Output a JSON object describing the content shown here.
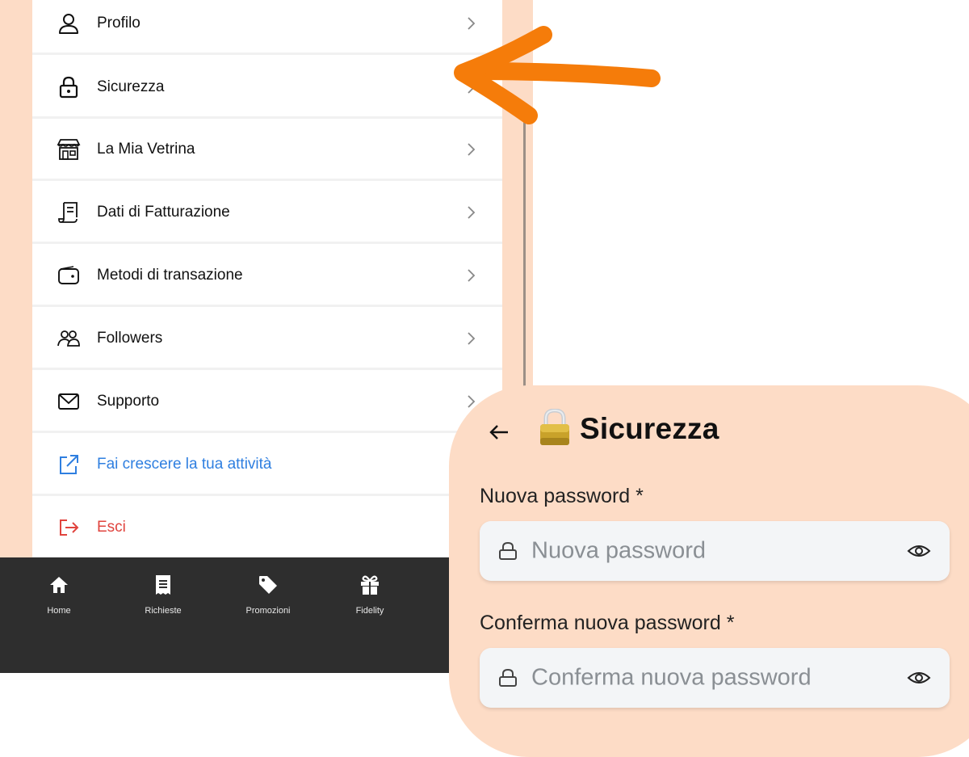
{
  "menu": {
    "items": [
      {
        "label": "Profilo",
        "icon": "user-icon"
      },
      {
        "label": "Sicurezza",
        "icon": "lock-icon"
      },
      {
        "label": "La Mia Vetrina",
        "icon": "store-icon"
      },
      {
        "label": "Dati di Fatturazione",
        "icon": "invoice-icon"
      },
      {
        "label": "Metodi di transazione",
        "icon": "wallet-icon"
      },
      {
        "label": "Followers",
        "icon": "users-icon"
      },
      {
        "label": "Supporto",
        "icon": "mail-icon"
      },
      {
        "label": "Fai crescere la tua attività",
        "icon": "external-link-icon"
      },
      {
        "label": "Esci",
        "icon": "logout-icon"
      }
    ]
  },
  "bottom_nav": {
    "items": [
      {
        "label": "Home",
        "icon": "home-icon"
      },
      {
        "label": "Richieste",
        "icon": "receipt-icon"
      },
      {
        "label": "Promozioni",
        "icon": "tag-icon"
      },
      {
        "label": "Fidelity",
        "icon": "gift-icon"
      }
    ]
  },
  "security": {
    "title": "Sicurezza",
    "new_password_label": "Nuova password *",
    "new_password_placeholder": "Nuova password",
    "confirm_password_label": "Conferma nuova password *",
    "confirm_password_placeholder": "Conferma nuova password"
  },
  "colors": {
    "card_bg": "#fddcc6",
    "arrow": "#f57c0a",
    "nav_bg": "#2e2e2e",
    "link_blue": "#2f7fe0",
    "logout_red": "#e0443e"
  }
}
